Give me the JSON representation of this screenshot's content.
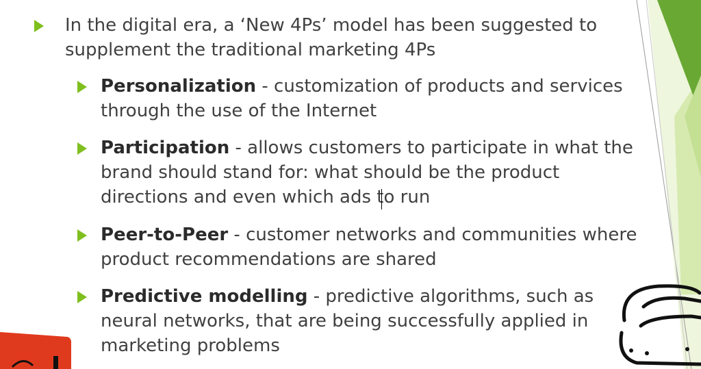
{
  "slide": {
    "intro": {
      "line1": "In the digital era, a ‘New 4Ps’ model has been suggested to",
      "line2": "supplement the traditional marketing 4Ps"
    },
    "items": [
      {
        "term": "Personalization",
        "line1_rest": " - customization of products and services",
        "line2": "through the use of the Internet"
      },
      {
        "term": "Participation",
        "line1_rest": " - allows customers to participate in what the",
        "line2": "brand should stand for: what should be the product",
        "line3": "directions and even which ads to run"
      },
      {
        "term": "Peer-to-Peer",
        "line1_rest": " - customer networks and communities where",
        "line2": "product recommendations are shared"
      },
      {
        "term": "Predictive modelling",
        "line1_rest": " - predictive algorithms, such as",
        "line2": "neural networks, that are being successfully applied in",
        "line3": "marketing problems"
      }
    ]
  },
  "colors": {
    "bullet": "#7fbf1e",
    "accent_dark": "#6aa834",
    "accent_light": "#d6eab0",
    "corner_red": "#e03a1e"
  }
}
